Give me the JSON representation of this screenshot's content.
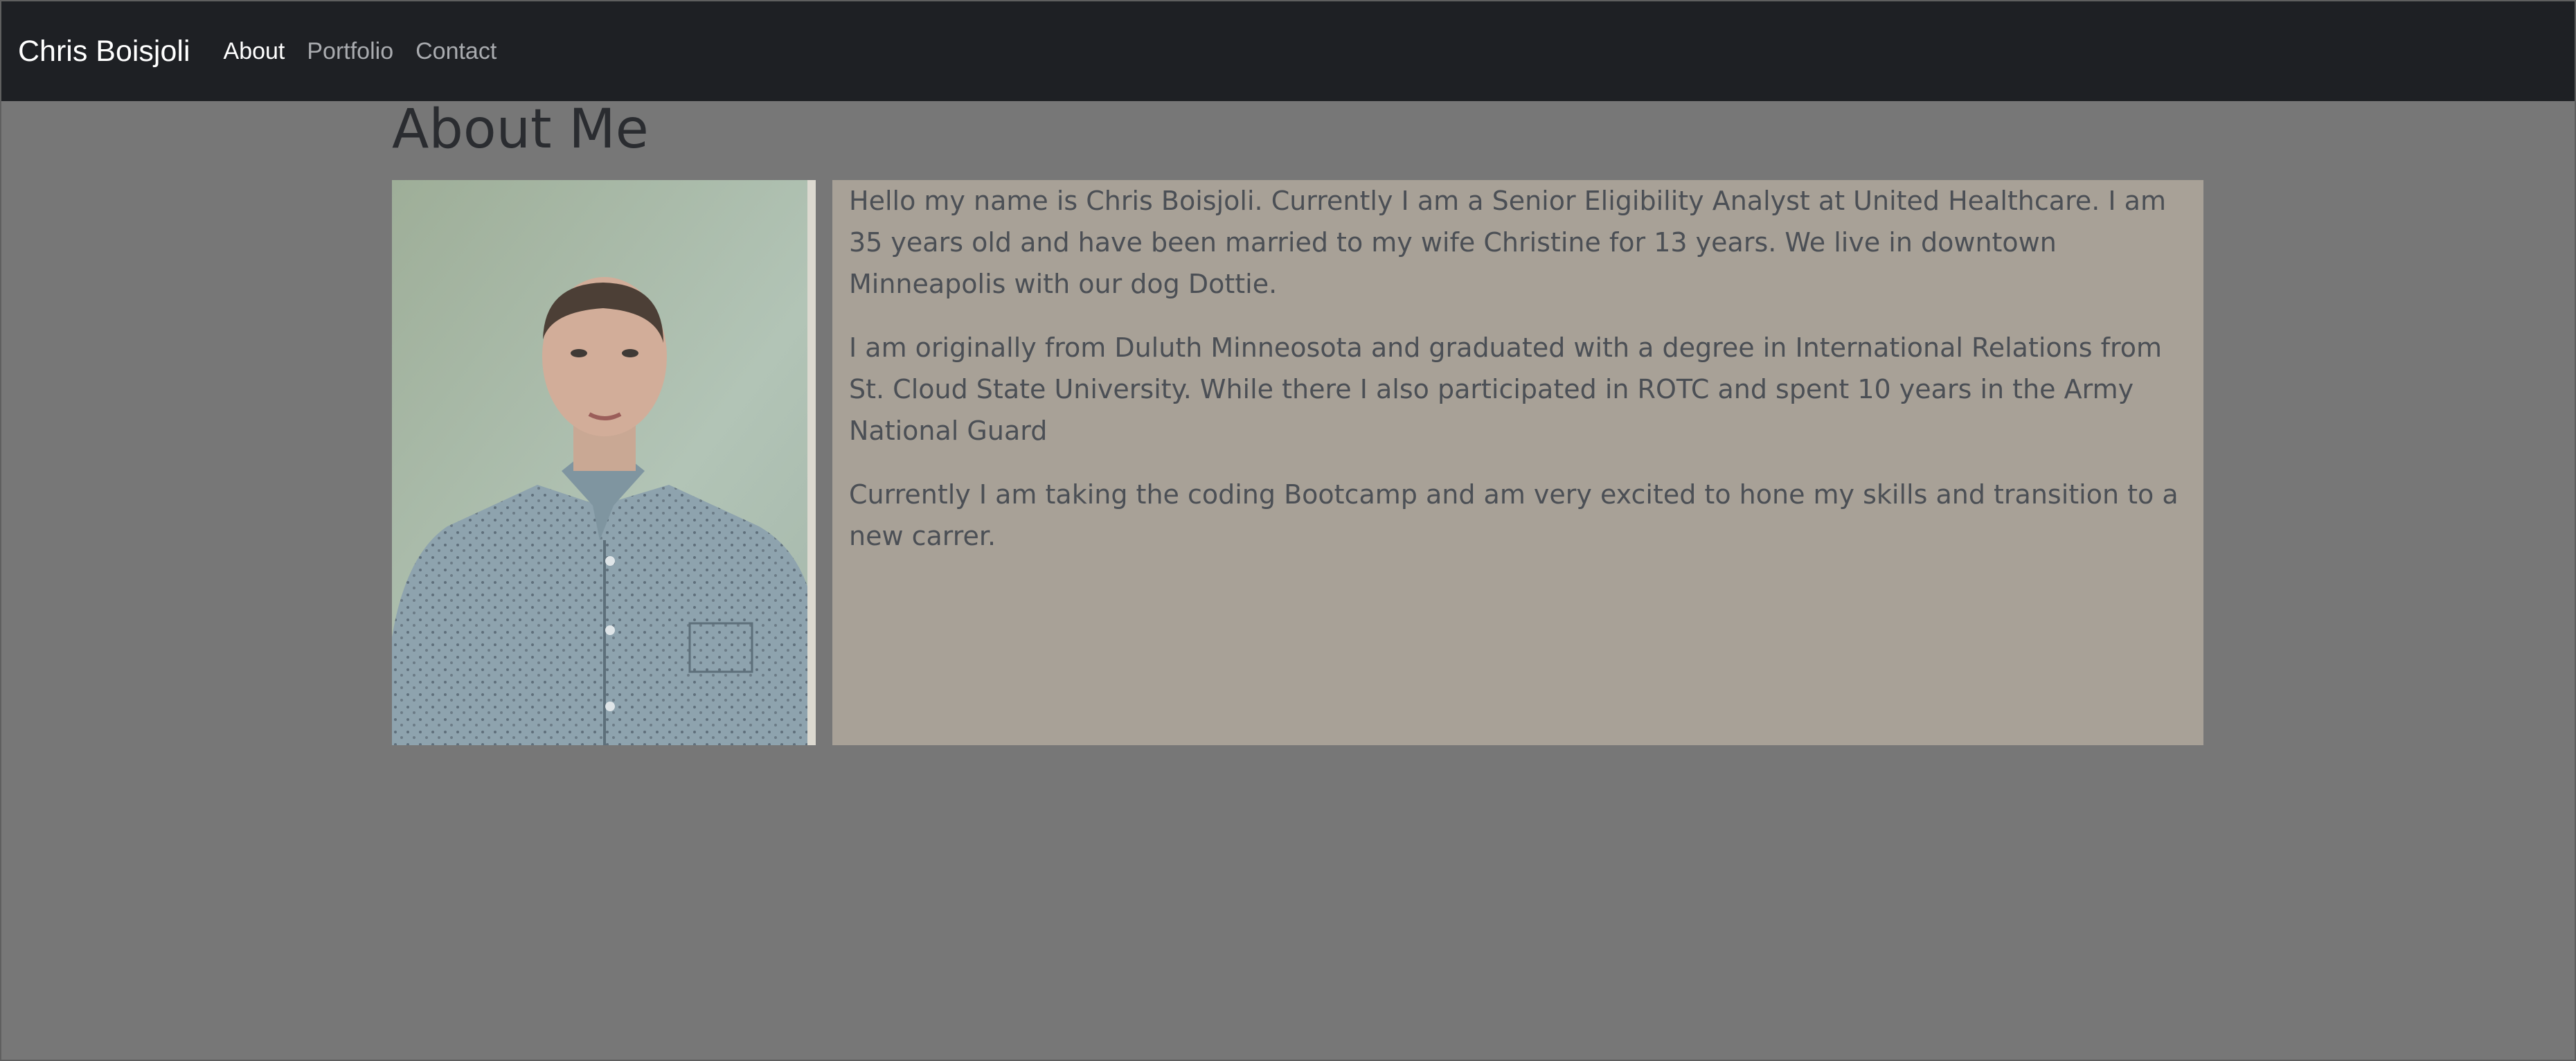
{
  "navbar": {
    "brand": "Chris Boisjoli",
    "links": [
      {
        "label": "About",
        "active": true
      },
      {
        "label": "Portfolio",
        "active": false
      },
      {
        "label": "Contact",
        "active": false
      }
    ]
  },
  "main": {
    "title": "About Me",
    "photo_icon": "profile-photo",
    "paragraphs": [
      "Hello my name is Chris Boisjoli. Currently I am a Senior Eligibility Analyst at United Healthcare. I am 35 years old and have been married to my wife Christine for 13 years. We live in downtown Minneapolis with our dog Dottie.",
      "I am originally from Duluth Minneosota and graduated with a degree in International Relations from St. Cloud State University. While there I also participated in ROTC and spent 10 years in the Army National Guard",
      "Currently I am taking the coding Bootcamp and am very excited to hone my skills and transition to a new carrer."
    ]
  },
  "colors": {
    "navbar_bg": "#1e2024",
    "page_bg": "#777777",
    "bio_bg": "#a8a197",
    "text": "#4b4f55"
  }
}
